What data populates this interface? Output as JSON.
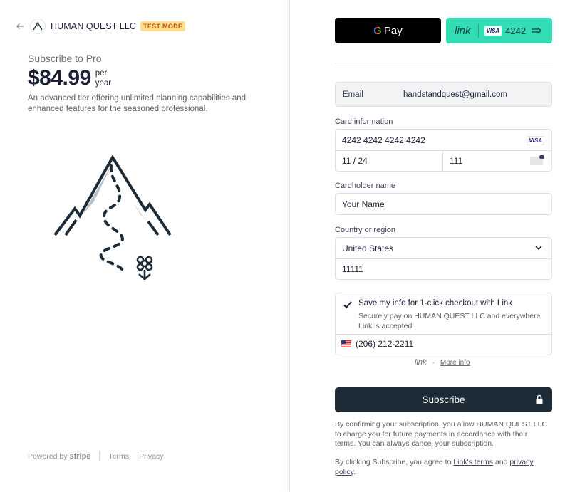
{
  "header": {
    "back_icon": "arrow-left-icon",
    "merchant_name": "HUMAN QUEST LLC",
    "badge": "TEST MODE"
  },
  "product": {
    "title": "Subscribe to Pro",
    "price": "$84.99",
    "per_line1": "per",
    "per_line2": "year",
    "description": "An advanced tier offering unlimited planning capabilities and enhanced features for the seasoned professional."
  },
  "footer": {
    "powered_by": "Powered by",
    "stripe": "stripe",
    "terms": "Terms",
    "privacy": "Privacy"
  },
  "wallets": {
    "gpay_g": "G",
    "gpay_label": "Pay",
    "link_label": "link",
    "link_card_brand": "VISA",
    "link_card_last4": "4242"
  },
  "email": {
    "label": "Email",
    "value": "handstandquest@gmail.com"
  },
  "card": {
    "section_label": "Card information",
    "number": "4242 4242 4242 4242",
    "brand": "VISA",
    "expiry": "11 / 24",
    "cvc": "111"
  },
  "cardholder": {
    "label": "Cardholder name",
    "placeholder": "Your Name"
  },
  "country": {
    "label": "Country or region",
    "selected": "United States",
    "zip": "11111"
  },
  "link_save": {
    "title": "Save my info for 1-click checkout with Link",
    "description": "Securely pay on HUMAN QUEST LLC and everywhere Link is accepted.",
    "phone": "(206) 212-2211",
    "checked": true
  },
  "link_footer": {
    "logo": "link",
    "dot": "·",
    "more_info": "More info"
  },
  "subscribe": {
    "label": "Subscribe"
  },
  "legal": {
    "consent": "By confirming your subscription, you allow HUMAN QUEST LLC to charge you for future payments in accordance with their terms. You can always cancel your subscription.",
    "agree_prefix": "By clicking Subscribe, you agree to ",
    "link_terms": "Link's terms",
    "and": " and ",
    "privacy_policy": "privacy policy",
    "period": "."
  },
  "colors": {
    "link_green": "#33ddb3",
    "subscribe_bg": "#1c2b36",
    "badge_bg": "#ffde92",
    "badge_text": "#bb5504"
  }
}
